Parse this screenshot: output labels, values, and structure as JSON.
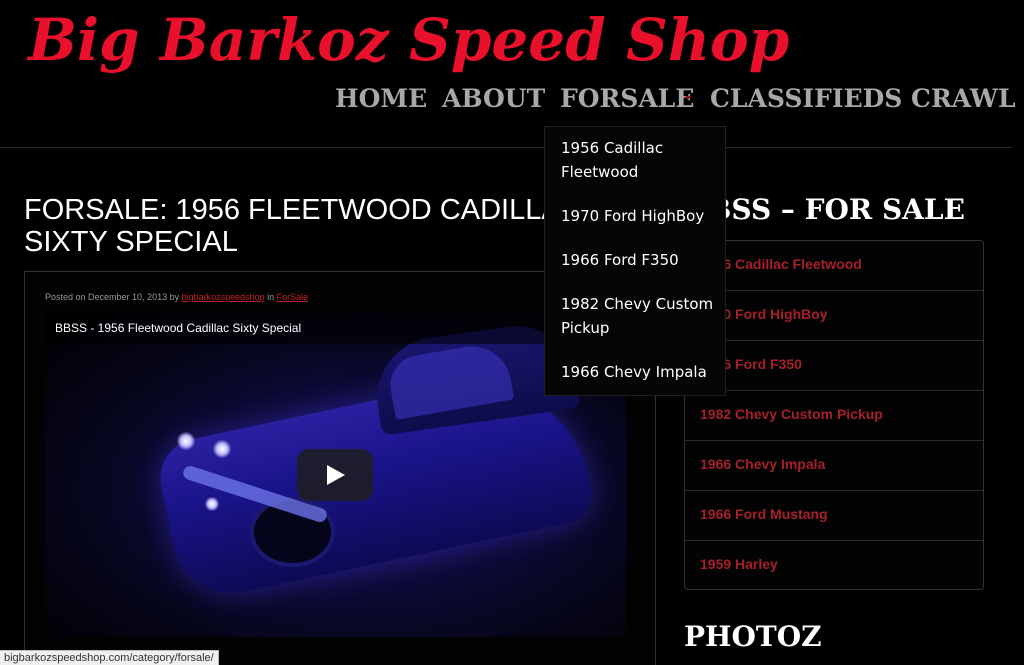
{
  "site": {
    "title": "Big Barkoz Speed Shop",
    "brand_color": "#e8102a"
  },
  "nav": {
    "items": [
      {
        "label": "HOME"
      },
      {
        "label": "ABOUT"
      },
      {
        "label": "FORSALE"
      },
      {
        "label": "CLASSIFIEDS CRAWL"
      }
    ],
    "dropdown": [
      {
        "label": "1956 Cadillac Fleetwood"
      },
      {
        "label": "1970 Ford HighBoy"
      },
      {
        "label": "1966 Ford F350"
      },
      {
        "label": "1982 Chevy Custom Pickup"
      },
      {
        "label": "1966 Chevy Impala"
      }
    ]
  },
  "post": {
    "title": "FORSALE: 1956 FLEETWOOD CADILLAC SIXTY SPECIAL",
    "meta_prefix": "Posted on December 10, 2013 by ",
    "author": "bigbarkozspeedshop",
    "meta_in": " in ",
    "category": "ForSale",
    "video_title": "BBSS - 1956 Fleetwood Cadillac Sixty Special"
  },
  "sidebar": {
    "title": "BBSS – FOR SALE",
    "items": [
      {
        "label": "1956 Cadillac Fleetwood"
      },
      {
        "label": "1970 Ford HighBoy"
      },
      {
        "label": "1966 Ford F350"
      },
      {
        "label": "1982 Chevy Custom Pickup"
      },
      {
        "label": "1966 Chevy Impala"
      },
      {
        "label": "1966 Ford Mustang"
      },
      {
        "label": "1959 Harley"
      }
    ],
    "photoz_title": "PHOTOZ"
  },
  "status_bar": {
    "url": "bigbarkozspeedshop.com/category/forsale/"
  }
}
